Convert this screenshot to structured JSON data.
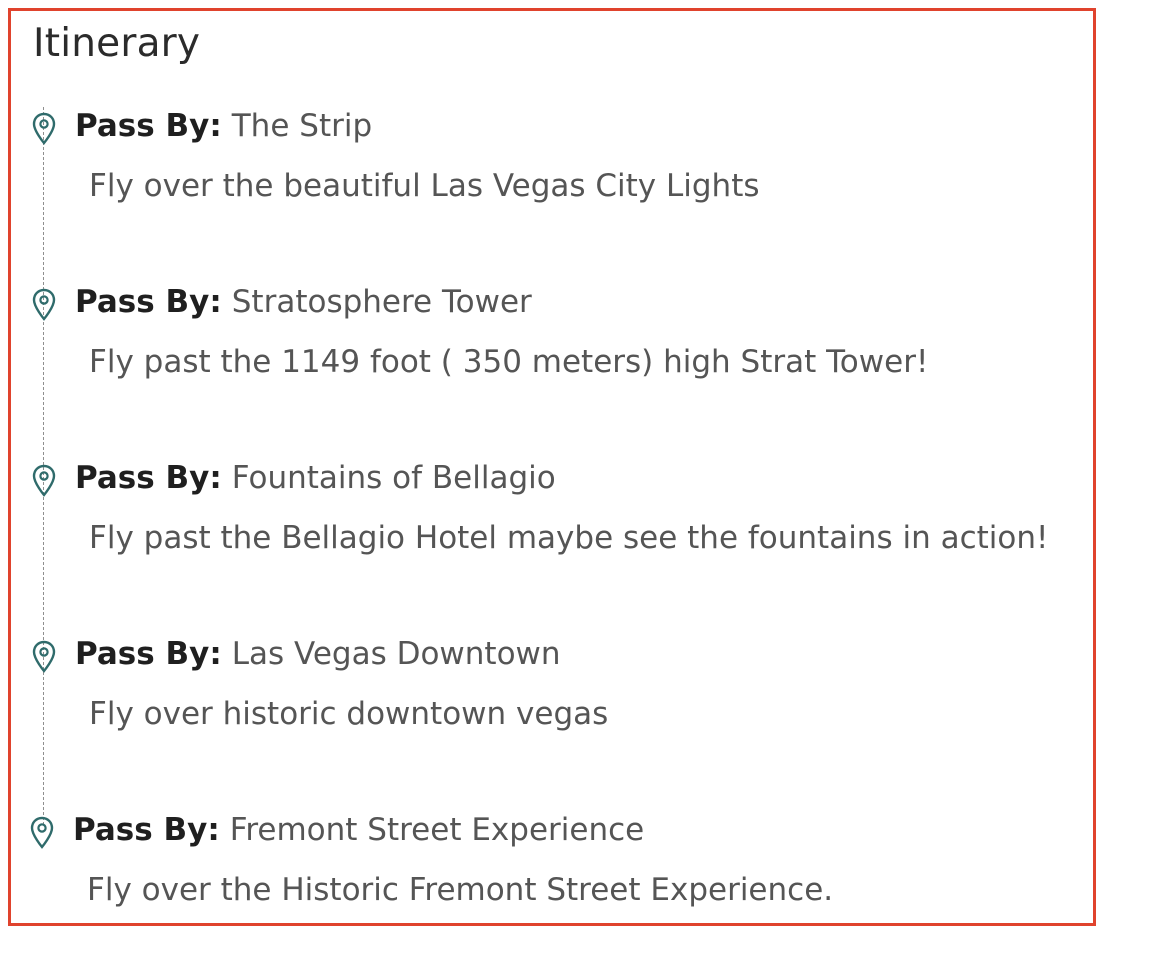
{
  "itinerary": {
    "title": "Itinerary",
    "accent_color": "#e0432d",
    "pin_color": "#2f6b6b",
    "pin_icon": "map-pin-icon",
    "stops": [
      {
        "label": "Pass By:",
        "place": "The Strip",
        "description": "Fly over the beautiful Las Vegas City Lights"
      },
      {
        "label": "Pass By:",
        "place": "Stratosphere Tower",
        "description": "Fly past the 1149 foot ( 350 meters) high Strat Tower!"
      },
      {
        "label": "Pass By:",
        "place": "Fountains of Bellagio",
        "description": "Fly past the Bellagio Hotel maybe see the fountains in action!"
      },
      {
        "label": "Pass By:",
        "place": "Las Vegas Downtown",
        "description": "Fly over historic downtown vegas"
      },
      {
        "label": "Pass By:",
        "place": "Fremont Street Experience",
        "description": "Fly over the Historic Fremont Street Experience."
      }
    ]
  }
}
